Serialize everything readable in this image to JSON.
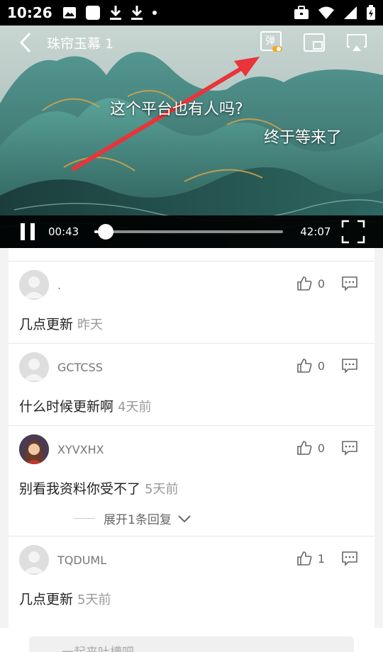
{
  "status": {
    "time": "10:26"
  },
  "video": {
    "title": "珠帘玉幕 1",
    "danmaku_button": "弹",
    "danmaku": [
      "这个平台也有人吗?",
      "终于等来了"
    ],
    "current_time": "00:43",
    "duration": "42:07",
    "progress": 0.017
  },
  "comments": [
    {
      "user": ".",
      "text": "几点更新",
      "when": "昨天",
      "likes": "0"
    },
    {
      "user": "GCTCSS",
      "text": "什么时候更新啊",
      "when": "4天前",
      "likes": "0"
    },
    {
      "user": "XYVXHX",
      "text": "别看我资料你受不了",
      "when": "5天前",
      "likes": "0",
      "expand": "展开1条回复"
    },
    {
      "user": "TQDUML",
      "text": "几点更新",
      "when": "5天前",
      "likes": "1"
    }
  ],
  "input": {
    "placeholder": "一起来吐槽吧"
  },
  "colors": {
    "annotation_arrow": "#e8343a",
    "accent": "#f5a623"
  }
}
